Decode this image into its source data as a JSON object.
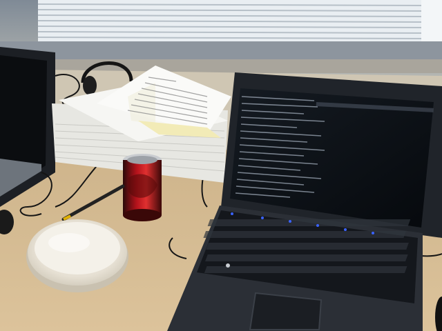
{
  "scene": {
    "objects": [
      "window-blinds",
      "left-monitor",
      "headphones",
      "paper-stack",
      "soda-can",
      "pen",
      "white-bowl",
      "laptop",
      "laptop-screen-terminal",
      "laptop-keyboard",
      "touchpad",
      "cables"
    ]
  },
  "colors": {
    "desk": "#d7bd93",
    "desk_shadow": "#b89a6f",
    "wall": "#9aa3ad",
    "window_light": "#eef3f6",
    "laptop_body": "#2b2f36",
    "screen_bg": "#0b0f14",
    "terminal_text": "#8c96a3",
    "can_red": "#b3121b",
    "bowl": "#f2efe6",
    "paper": "#f4f4f2",
    "key_light": "#3a63ff"
  }
}
